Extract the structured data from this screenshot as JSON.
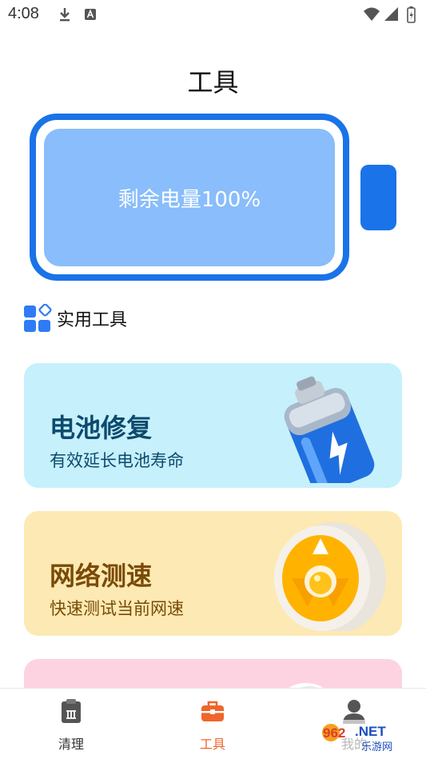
{
  "status": {
    "time": "4:08"
  },
  "header": {
    "title": "工具"
  },
  "battery": {
    "label": "剩余电量100%"
  },
  "section": {
    "title": "实用工具"
  },
  "cards": [
    {
      "title": "电池修复",
      "subtitle": "有效延长电池寿命",
      "bg": "#c6f0fb",
      "title_color": "#0c4a6e",
      "subtitle_color": "#0c4a6e",
      "art": "battery-3d-icon"
    },
    {
      "title": "网络测速",
      "subtitle": "快速测试当前网速",
      "bg": "#fde9b3",
      "title_color": "#7a4a06",
      "subtitle_color": "#7a4a06",
      "art": "speed-gauge-3d-icon"
    },
    {
      "title": "",
      "subtitle": "",
      "bg": "#fdd3e1",
      "art": "headphones-3d-icon"
    }
  ],
  "nav": {
    "items": [
      {
        "label": "清理",
        "icon": "clipboard-icon",
        "active": false
      },
      {
        "label": "工具",
        "icon": "toolbox-icon",
        "active": true
      },
      {
        "label": "我的",
        "icon": "person-icon",
        "active": false
      }
    ],
    "active_color": "#f0652b",
    "inactive_color": "#555555"
  },
  "watermark": {
    "text": "962.NET",
    "sub": "乐游网"
  }
}
